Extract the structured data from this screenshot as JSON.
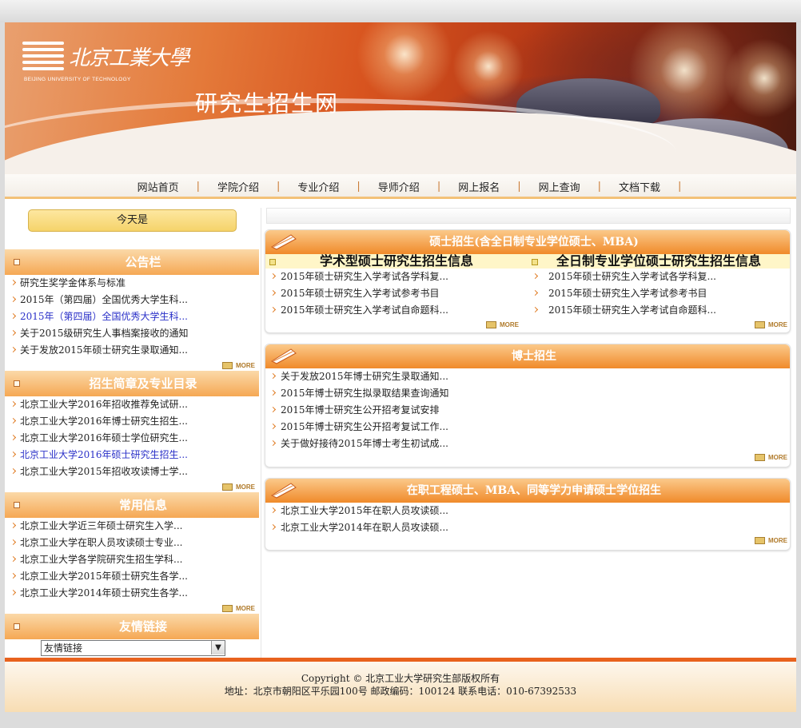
{
  "banner": {
    "logo_cn": "北京工業大學",
    "logo_en": "BEIJING UNIVERSITY OF TECHNOLOGY",
    "site_title": "研究生招生网"
  },
  "nav": {
    "items": [
      "网站首页",
      "学院介绍",
      "专业介绍",
      "导师介绍",
      "网上报名",
      "网上查询",
      "文档下载"
    ]
  },
  "sidebar": {
    "today_label": "今天是",
    "more_label": "MORE",
    "notice": {
      "title": "公告栏",
      "items": [
        "研究生奖学金体系与标准",
        "2015年（第四届）全国优秀大学生科...",
        "2015年（第四届）全国优秀大学生科...",
        "关于2015级研究生人事档案接收的通知",
        "关于发放2015年硕士研究生录取通知..."
      ]
    },
    "admission": {
      "title": "招生简章及专业目录",
      "items": [
        "北京工业大学2016年招收推荐免试研...",
        "北京工业大学2016年博士研究生招生...",
        "北京工业大学2016年硕士学位研究生...",
        "北京工业大学2016年硕士研究生招生...",
        "北京工业大学2015年招收攻读博士学..."
      ]
    },
    "common": {
      "title": "常用信息",
      "items": [
        "北京工业大学近三年硕士研究生入学...",
        "北京工业大学在职人员攻读硕士专业...",
        "北京工业大学各学院研究生招生学科...",
        "北京工业大学2015年硕士研究生各学...",
        "北京工业大学2014年硕士研究生各学..."
      ]
    },
    "links": {
      "title": "友情链接",
      "select_value": "友情链接"
    }
  },
  "main": {
    "master": {
      "title": "硕士招生(含全日制专业学位硕士、MBA)",
      "academic": {
        "title": "学术型硕士研究生招生信息",
        "items": [
          "2015年硕士研究生入学考试各学科复...",
          "2015年硕士研究生入学考试参考书目",
          "2015年硕士研究生入学考试自命题科..."
        ]
      },
      "professional": {
        "title": "全日制专业学位硕士研究生招生信息",
        "items": [
          "2015年硕士研究生入学考试各学科复...",
          "2015年硕士研究生入学考试参考书目",
          "2015年硕士研究生入学考试自命题科..."
        ]
      }
    },
    "doctor": {
      "title": "博士招生",
      "items": [
        "关于发放2015年博士研究生录取通知...",
        "2015年博士研究生拟录取结果查询通知",
        "2015年博士研究生公开招考复试安排",
        "2015年博士研究生公开招考复试工作...",
        "关于做好接待2015年博士考生初试成..."
      ]
    },
    "onjob": {
      "title": "在职工程硕士、MBA、同等学力申请硕士学位招生",
      "items": [
        "北京工业大学2015年在职人员攻读硕...",
        "北京工业大学2014年在职人员攻读硕..."
      ]
    }
  },
  "footer": {
    "copyright": "Copyright © 北京工业大学研究生部版权所有",
    "address": "地址：北京市朝阳区平乐园100号  邮政编码：100124 联系电话：010-67392533"
  }
}
